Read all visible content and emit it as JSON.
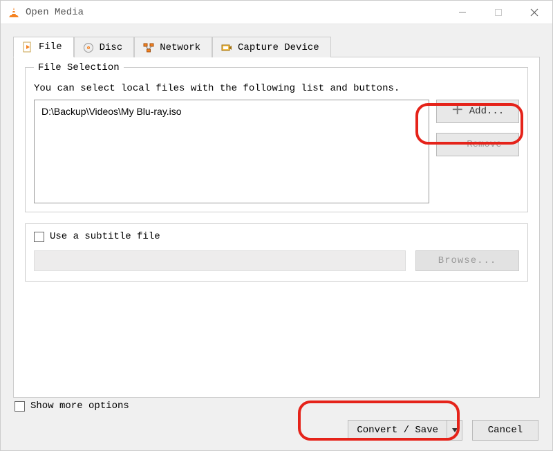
{
  "window": {
    "title": "Open Media"
  },
  "tabs": {
    "file": "File",
    "disc": "Disc",
    "network": "Network",
    "capture": "Capture Device"
  },
  "file_section": {
    "legend": "File Selection",
    "instruction": "You can select local files with the following list and buttons.",
    "item": "D:\\Backup\\Videos\\My Blu-ray.iso",
    "add": "Add...",
    "remove": "Remove"
  },
  "subtitle": {
    "label": "Use a subtitle file",
    "browse": "Browse..."
  },
  "bottom": {
    "more": "Show more options",
    "convert": "Convert / Save",
    "cancel": "Cancel"
  }
}
